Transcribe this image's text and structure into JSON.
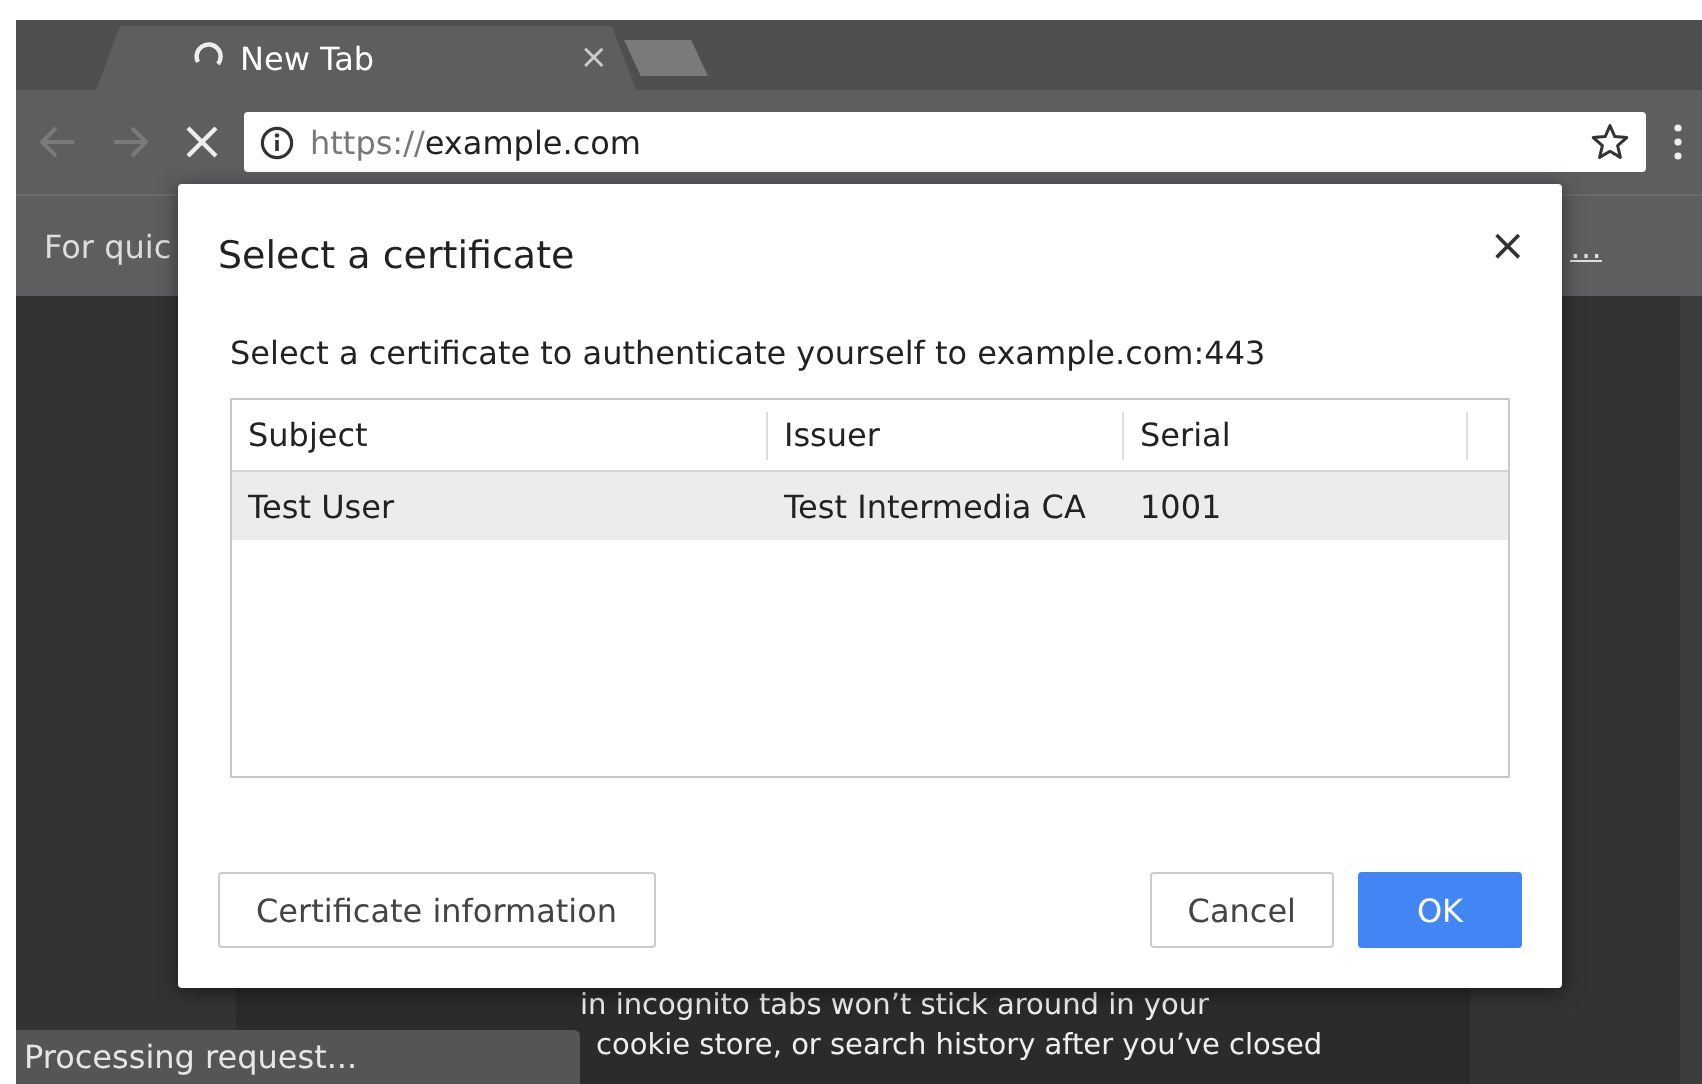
{
  "tabs": [
    {
      "title": "New Tab",
      "selected": true,
      "loading": true,
      "close": "×"
    }
  ],
  "toolbar": {
    "back_disabled": true,
    "forward_disabled": true,
    "address": {
      "scheme": "https://",
      "host": "example.com"
    }
  },
  "bookmark_bar": {
    "left_text": "For quic",
    "right_text": "…"
  },
  "page": {
    "lines": [
      "in incognito tabs won’t stick around in your",
      "cookie store, or search history after you’ve closed"
    ]
  },
  "dialog": {
    "title": "Select a certificate",
    "close": "×",
    "message": "Select a certificate to authenticate yourself to example.com:443",
    "table": {
      "columns": [
        "Subject",
        "Issuer",
        "Serial"
      ],
      "rows": [
        {
          "cells": [
            "Test User",
            "Test Intermedia CA",
            "1001"
          ],
          "selected": true
        }
      ]
    },
    "buttons": [
      {
        "label": "Certificate information",
        "kind": "secondary"
      },
      {
        "label": "Cancel",
        "kind": "secondary"
      },
      {
        "label": "OK",
        "kind": "primary"
      }
    ]
  },
  "status_bubble": {
    "text": "Processing request..."
  }
}
